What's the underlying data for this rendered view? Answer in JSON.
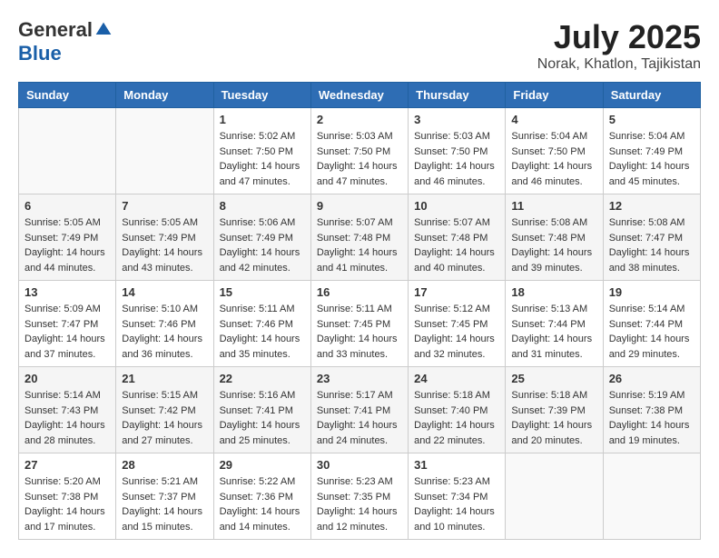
{
  "header": {
    "logo_general": "General",
    "logo_blue": "Blue",
    "month_title": "July 2025",
    "location": "Norak, Khatlon, Tajikistan"
  },
  "days_of_week": [
    "Sunday",
    "Monday",
    "Tuesday",
    "Wednesday",
    "Thursday",
    "Friday",
    "Saturday"
  ],
  "weeks": [
    [
      {
        "day": "",
        "detail": ""
      },
      {
        "day": "",
        "detail": ""
      },
      {
        "day": "1",
        "detail": "Sunrise: 5:02 AM\nSunset: 7:50 PM\nDaylight: 14 hours and 47 minutes."
      },
      {
        "day": "2",
        "detail": "Sunrise: 5:03 AM\nSunset: 7:50 PM\nDaylight: 14 hours and 47 minutes."
      },
      {
        "day": "3",
        "detail": "Sunrise: 5:03 AM\nSunset: 7:50 PM\nDaylight: 14 hours and 46 minutes."
      },
      {
        "day": "4",
        "detail": "Sunrise: 5:04 AM\nSunset: 7:50 PM\nDaylight: 14 hours and 46 minutes."
      },
      {
        "day": "5",
        "detail": "Sunrise: 5:04 AM\nSunset: 7:49 PM\nDaylight: 14 hours and 45 minutes."
      }
    ],
    [
      {
        "day": "6",
        "detail": "Sunrise: 5:05 AM\nSunset: 7:49 PM\nDaylight: 14 hours and 44 minutes."
      },
      {
        "day": "7",
        "detail": "Sunrise: 5:05 AM\nSunset: 7:49 PM\nDaylight: 14 hours and 43 minutes."
      },
      {
        "day": "8",
        "detail": "Sunrise: 5:06 AM\nSunset: 7:49 PM\nDaylight: 14 hours and 42 minutes."
      },
      {
        "day": "9",
        "detail": "Sunrise: 5:07 AM\nSunset: 7:48 PM\nDaylight: 14 hours and 41 minutes."
      },
      {
        "day": "10",
        "detail": "Sunrise: 5:07 AM\nSunset: 7:48 PM\nDaylight: 14 hours and 40 minutes."
      },
      {
        "day": "11",
        "detail": "Sunrise: 5:08 AM\nSunset: 7:48 PM\nDaylight: 14 hours and 39 minutes."
      },
      {
        "day": "12",
        "detail": "Sunrise: 5:08 AM\nSunset: 7:47 PM\nDaylight: 14 hours and 38 minutes."
      }
    ],
    [
      {
        "day": "13",
        "detail": "Sunrise: 5:09 AM\nSunset: 7:47 PM\nDaylight: 14 hours and 37 minutes."
      },
      {
        "day": "14",
        "detail": "Sunrise: 5:10 AM\nSunset: 7:46 PM\nDaylight: 14 hours and 36 minutes."
      },
      {
        "day": "15",
        "detail": "Sunrise: 5:11 AM\nSunset: 7:46 PM\nDaylight: 14 hours and 35 minutes."
      },
      {
        "day": "16",
        "detail": "Sunrise: 5:11 AM\nSunset: 7:45 PM\nDaylight: 14 hours and 33 minutes."
      },
      {
        "day": "17",
        "detail": "Sunrise: 5:12 AM\nSunset: 7:45 PM\nDaylight: 14 hours and 32 minutes."
      },
      {
        "day": "18",
        "detail": "Sunrise: 5:13 AM\nSunset: 7:44 PM\nDaylight: 14 hours and 31 minutes."
      },
      {
        "day": "19",
        "detail": "Sunrise: 5:14 AM\nSunset: 7:44 PM\nDaylight: 14 hours and 29 minutes."
      }
    ],
    [
      {
        "day": "20",
        "detail": "Sunrise: 5:14 AM\nSunset: 7:43 PM\nDaylight: 14 hours and 28 minutes."
      },
      {
        "day": "21",
        "detail": "Sunrise: 5:15 AM\nSunset: 7:42 PM\nDaylight: 14 hours and 27 minutes."
      },
      {
        "day": "22",
        "detail": "Sunrise: 5:16 AM\nSunset: 7:41 PM\nDaylight: 14 hours and 25 minutes."
      },
      {
        "day": "23",
        "detail": "Sunrise: 5:17 AM\nSunset: 7:41 PM\nDaylight: 14 hours and 24 minutes."
      },
      {
        "day": "24",
        "detail": "Sunrise: 5:18 AM\nSunset: 7:40 PM\nDaylight: 14 hours and 22 minutes."
      },
      {
        "day": "25",
        "detail": "Sunrise: 5:18 AM\nSunset: 7:39 PM\nDaylight: 14 hours and 20 minutes."
      },
      {
        "day": "26",
        "detail": "Sunrise: 5:19 AM\nSunset: 7:38 PM\nDaylight: 14 hours and 19 minutes."
      }
    ],
    [
      {
        "day": "27",
        "detail": "Sunrise: 5:20 AM\nSunset: 7:38 PM\nDaylight: 14 hours and 17 minutes."
      },
      {
        "day": "28",
        "detail": "Sunrise: 5:21 AM\nSunset: 7:37 PM\nDaylight: 14 hours and 15 minutes."
      },
      {
        "day": "29",
        "detail": "Sunrise: 5:22 AM\nSunset: 7:36 PM\nDaylight: 14 hours and 14 minutes."
      },
      {
        "day": "30",
        "detail": "Sunrise: 5:23 AM\nSunset: 7:35 PM\nDaylight: 14 hours and 12 minutes."
      },
      {
        "day": "31",
        "detail": "Sunrise: 5:23 AM\nSunset: 7:34 PM\nDaylight: 14 hours and 10 minutes."
      },
      {
        "day": "",
        "detail": ""
      },
      {
        "day": "",
        "detail": ""
      }
    ]
  ]
}
